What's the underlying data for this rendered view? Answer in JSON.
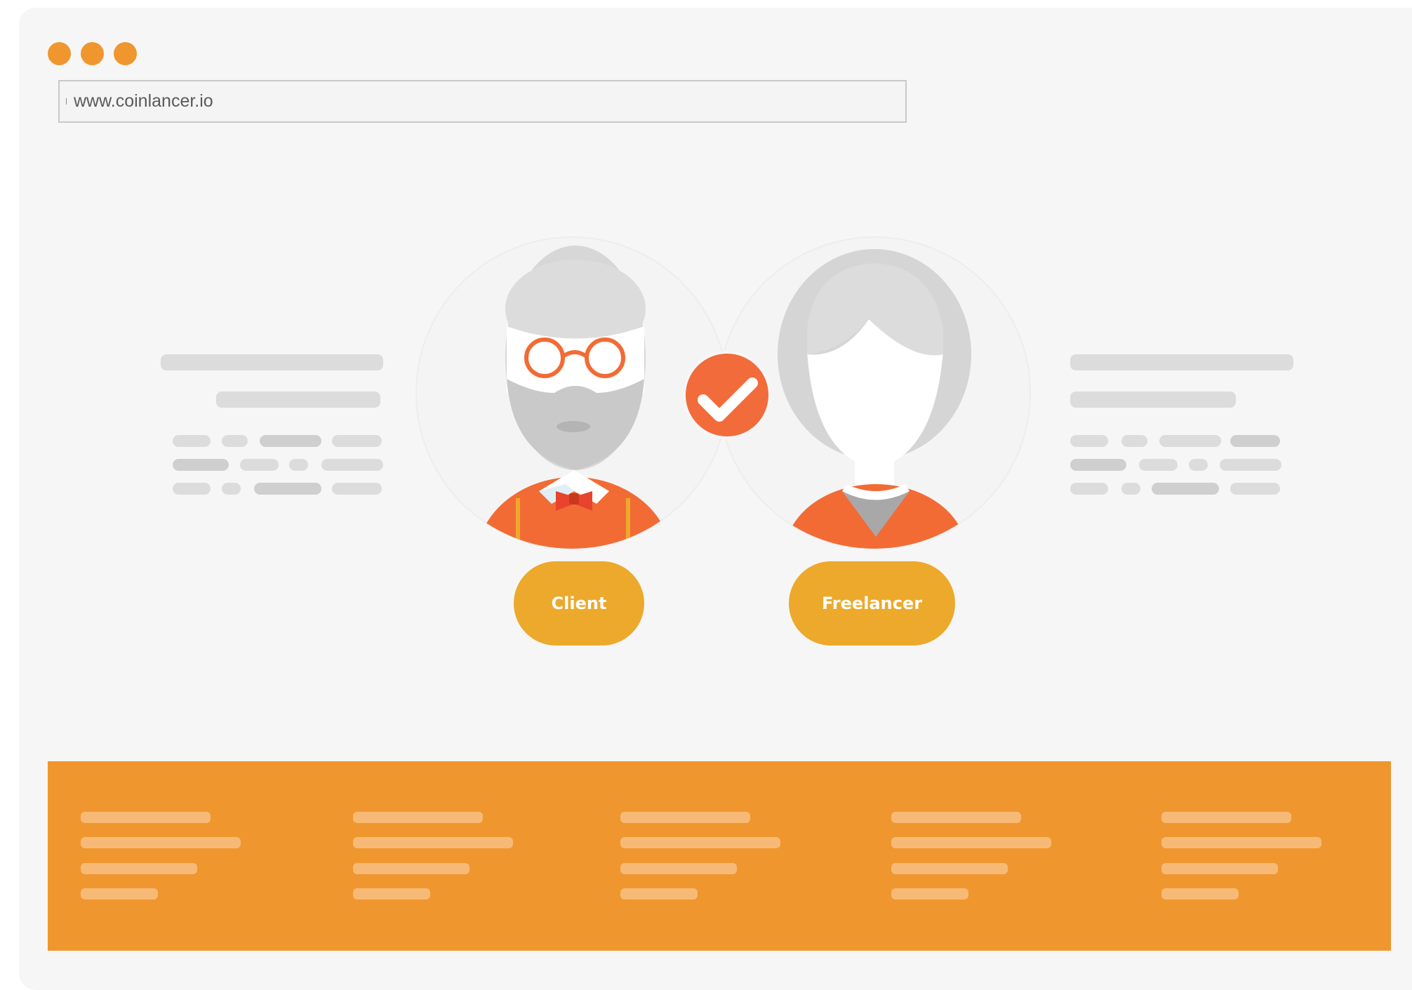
{
  "window": {
    "controls": [
      {
        "name": "close",
        "color": "#f0962e"
      },
      {
        "name": "minimize",
        "color": "#f0962e"
      },
      {
        "name": "maximize",
        "color": "#f0962e"
      }
    ],
    "address_bar": {
      "url": "www.coinlancer.io"
    }
  },
  "main": {
    "client": {
      "label": "Client",
      "icon": "client-avatar-icon"
    },
    "freelancer": {
      "label": "Freelancer",
      "icon": "freelancer-avatar-icon"
    },
    "match_icon": "checkmark-icon"
  },
  "colors": {
    "accent": "#f0962e",
    "button": "#eca92c",
    "check": "#f26b3a",
    "placeholder": "#dcdcdc",
    "placeholder_dark": "#cfcfcf",
    "footer_bar": "#f6ba76"
  }
}
